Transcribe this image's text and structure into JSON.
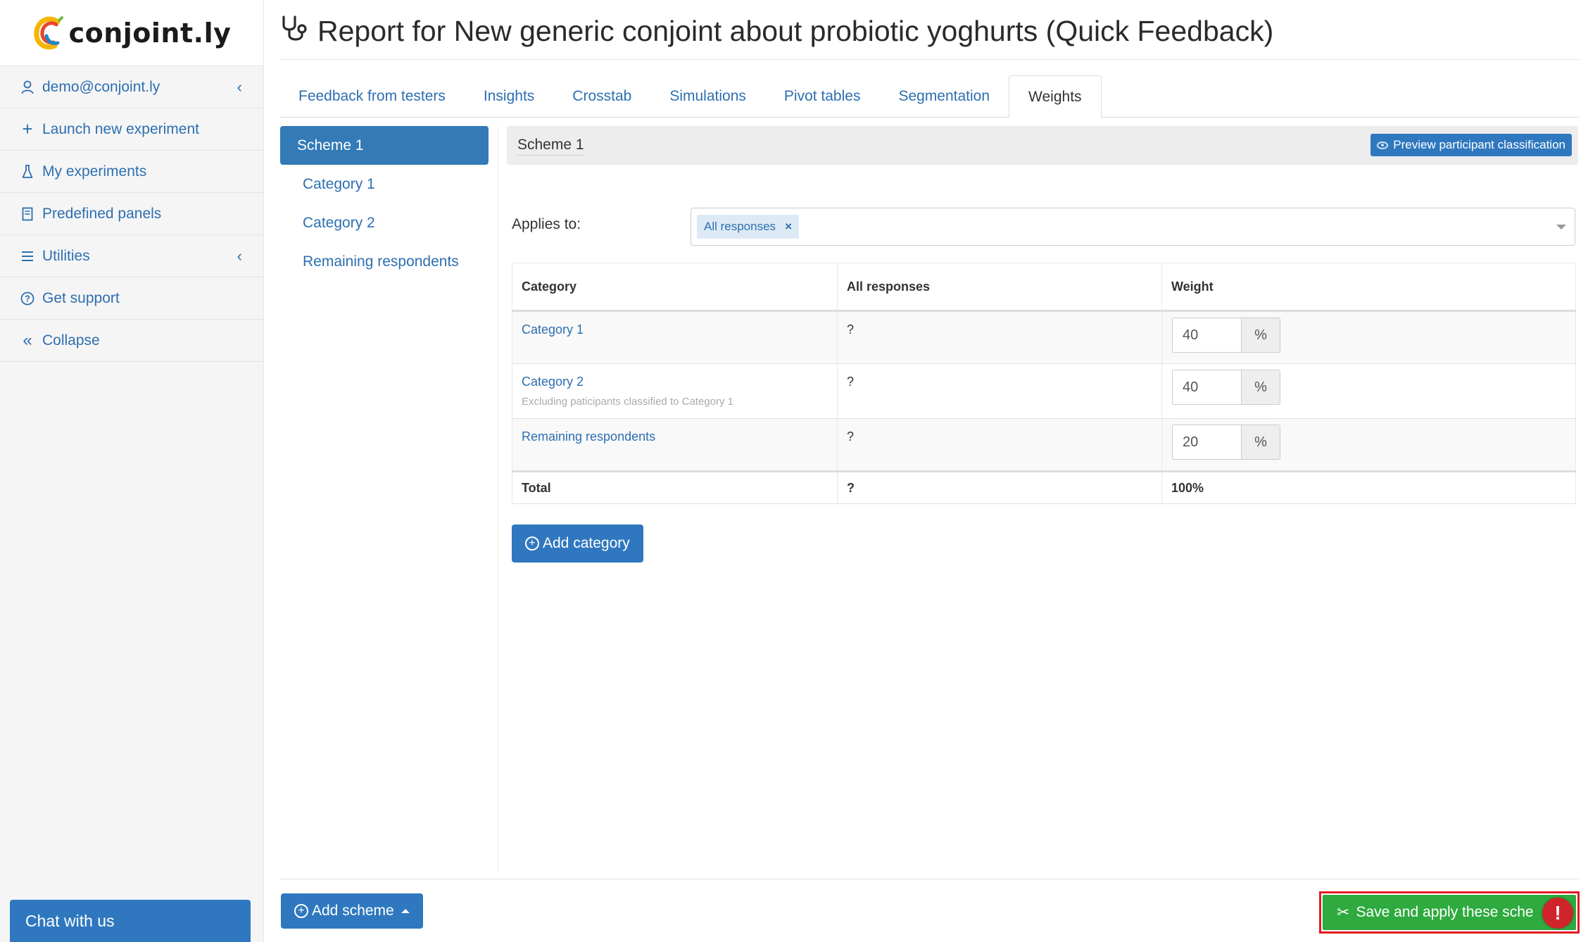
{
  "brand": {
    "logo_text": "conjoint.ly"
  },
  "sidebar": {
    "items": [
      {
        "label": "demo@conjoint.ly",
        "icon": "user-icon",
        "has_chevron": true
      },
      {
        "label": "Launch new experiment",
        "icon": "plus-icon"
      },
      {
        "label": "My experiments",
        "icon": "flask-icon"
      },
      {
        "label": "Predefined panels",
        "icon": "book-icon"
      },
      {
        "label": "Utilities",
        "icon": "menu-icon",
        "has_chevron": true
      },
      {
        "label": "Get support",
        "icon": "question-circle-icon"
      },
      {
        "label": "Collapse",
        "icon": "double-chevron-left-icon"
      }
    ],
    "chat_label": "Chat with us"
  },
  "header": {
    "title": "Report for New generic conjoint about probiotic yoghurts (Quick Feedback)",
    "icon": "stethoscope-icon"
  },
  "tabs": [
    {
      "label": "Feedback from testers"
    },
    {
      "label": "Insights"
    },
    {
      "label": "Crosstab"
    },
    {
      "label": "Simulations"
    },
    {
      "label": "Pivot tables"
    },
    {
      "label": "Segmentation"
    },
    {
      "label": "Weights",
      "active": true
    }
  ],
  "schemes": {
    "items": [
      {
        "label": "Scheme 1",
        "active": true
      },
      {
        "label": "Category 1"
      },
      {
        "label": "Category 2"
      },
      {
        "label": "Remaining respondents"
      }
    ]
  },
  "panel": {
    "scheme_name": "Scheme 1",
    "preview_label": "Preview participant classification",
    "applies_label": "Applies to:",
    "applies_tag": "All responses",
    "table": {
      "headers": [
        "Category",
        "All responses",
        "Weight"
      ],
      "rows": [
        {
          "category": "Category 1",
          "note": "",
          "responses": "?",
          "weight": "40",
          "unit": "%"
        },
        {
          "category": "Category 2",
          "note": "Excluding paticipants classified to Category 1",
          "responses": "?",
          "weight": "40",
          "unit": "%"
        },
        {
          "category": "Remaining respondents",
          "note": "",
          "responses": "?",
          "weight": "20",
          "unit": "%"
        }
      ],
      "total": {
        "label": "Total",
        "responses": "?",
        "weight": "100%"
      }
    },
    "add_category_label": "Add category"
  },
  "footer": {
    "add_scheme_label": "Add scheme",
    "save_label": "Save and apply these sche",
    "alert": "!"
  },
  "colors": {
    "primary": "#337ab7",
    "link": "#2d6fb0",
    "success": "#2eaa3e",
    "highlight": "#e21b23"
  }
}
